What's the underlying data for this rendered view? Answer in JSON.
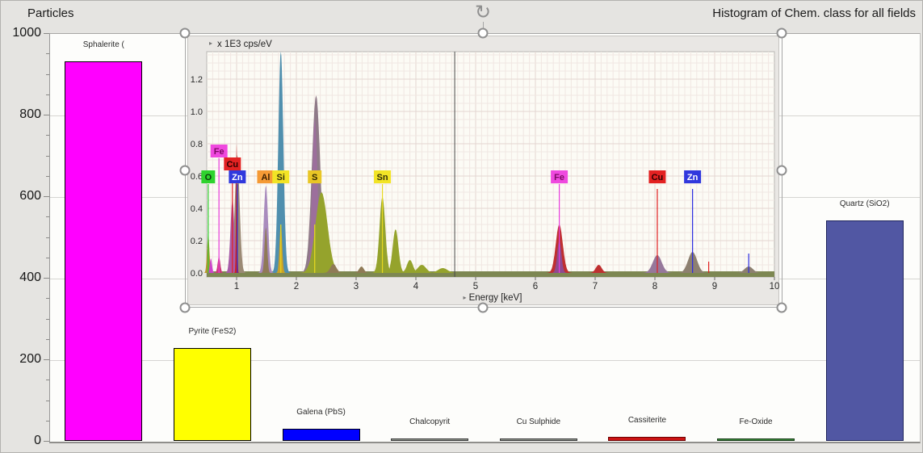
{
  "header": {
    "left_title": "Particles",
    "right_title": "Histogram of Chem. class for all fields"
  },
  "icons": {
    "rotate": "↻",
    "axis_arrow": "▸"
  },
  "chart_data": [
    {
      "type": "bar",
      "title": "Histogram of Chem. class for all fields",
      "ylabel": "Particles",
      "ylim": [
        0,
        1000
      ],
      "y_ticks": [
        0,
        200,
        400,
        600,
        800,
        1000
      ],
      "y_minor_step": 50,
      "grid": true,
      "categories": [
        "Sphalerite (",
        "Pyrite (FeS2)",
        "Galena (PbS)",
        "Chalcopyrit",
        "Cu Sulphide",
        "Cassiterite",
        "Fe-Oxide",
        "Quartz (SiO2)"
      ],
      "values": [
        930,
        228,
        30,
        5,
        4,
        9,
        5,
        540
      ],
      "bar_colors": [
        "#ff00ff",
        "#ffff00",
        "#0000ff",
        "#8d938b",
        "#8d938b",
        "#cc1414",
        "#3a8a3a",
        "#5157a3"
      ],
      "bar_borders": [
        "#000000",
        "#000000",
        "#000010",
        "#3a3a3a",
        "#3a3a3a",
        "#6b0000",
        "#143914",
        "#20265c"
      ]
    },
    {
      "type": "area",
      "title": "EDS sum spectrum overlay",
      "unit_label": "x 1E3 cps/eV",
      "xlabel": "Energy [keV]",
      "xlim": [
        0.5,
        10
      ],
      "ylim": [
        0,
        1.4
      ],
      "x_ticks": [
        1,
        2,
        3,
        4,
        5,
        6,
        7,
        8,
        9,
        10
      ],
      "y_tick_labels": [
        "0.0",
        "0.2",
        "0.4",
        "0.6",
        "0.8",
        "1.0",
        "1.2"
      ],
      "cursor_kev": 4.65,
      "baseline_band": {
        "h": 0.012,
        "color": "#7d8752"
      },
      "peaks": [
        {
          "e": 1.74,
          "h": 1.37,
          "w": 0.042,
          "color": "#4f8fae"
        },
        {
          "e": 1.74,
          "h": 0.3,
          "w": 0.022,
          "color": "#c9a227"
        },
        {
          "e": 2.33,
          "h": 1.1,
          "w": 0.07,
          "color": "#8f7a88"
        },
        {
          "e": 2.31,
          "h": 0.95,
          "w": 0.045,
          "color": "#9c6f9c"
        },
        {
          "e": 2.42,
          "h": 0.5,
          "w": 0.1,
          "color": "#95a32c"
        },
        {
          "e": 2.62,
          "h": 0.055,
          "w": 0.05,
          "color": "#8f7a56"
        },
        {
          "e": 1.49,
          "h": 0.54,
          "w": 0.036,
          "color": "#a98bbd"
        },
        {
          "e": 1.49,
          "h": 0.28,
          "w": 0.022,
          "color": "#8f7a56"
        },
        {
          "e": 1.01,
          "h": 0.73,
          "w": 0.04,
          "color": "#9b8a75"
        },
        {
          "e": 0.93,
          "h": 0.45,
          "w": 0.033,
          "color": "#a85ca8"
        },
        {
          "e": 1.0,
          "h": 0.8,
          "w": 0.01,
          "color": "#cc2525"
        },
        {
          "e": 0.525,
          "h": 0.24,
          "w": 0.02,
          "color": "#b5952f"
        },
        {
          "e": 0.57,
          "h": 0.09,
          "w": 0.018,
          "color": "#cc44cc"
        },
        {
          "e": 0.705,
          "h": 0.1,
          "w": 0.022,
          "color": "#cc3a7a"
        },
        {
          "e": 3.09,
          "h": 0.04,
          "w": 0.04,
          "color": "#8f7a56"
        },
        {
          "e": 3.44,
          "h": 0.47,
          "w": 0.048,
          "color": "#95a32c"
        },
        {
          "e": 3.66,
          "h": 0.27,
          "w": 0.048,
          "color": "#95a32c"
        },
        {
          "e": 3.9,
          "h": 0.08,
          "w": 0.05,
          "color": "#95a32c"
        },
        {
          "e": 4.1,
          "h": 0.05,
          "w": 0.07,
          "color": "#95a32c"
        },
        {
          "e": 4.45,
          "h": 0.03,
          "w": 0.08,
          "color": "#95a32c"
        },
        {
          "e": 6.4,
          "h": 0.3,
          "w": 0.058,
          "color": "#bf3030"
        },
        {
          "e": 6.4,
          "h": 0.2,
          "w": 0.035,
          "color": "#8f4a8f"
        },
        {
          "e": 7.06,
          "h": 0.05,
          "w": 0.05,
          "color": "#bf3030"
        },
        {
          "e": 8.04,
          "h": 0.11,
          "w": 0.075,
          "color": "#96789b"
        },
        {
          "e": 8.63,
          "h": 0.13,
          "w": 0.075,
          "color": "#8d8070"
        },
        {
          "e": 9.57,
          "h": 0.04,
          "w": 0.07,
          "color": "#8d8070"
        }
      ],
      "markers": [
        {
          "e": 0.525,
          "to": 0.55,
          "color": "#2ecc2e"
        },
        {
          "e": 0.705,
          "to": 0.71,
          "color": "#e83ddd"
        },
        {
          "e": 0.93,
          "to": 0.63,
          "color": "#e02020"
        },
        {
          "e": 1.012,
          "to": 0.55,
          "color": "#2a2ae0"
        },
        {
          "e": 1.74,
          "to": 0.3,
          "color": "#e8d820"
        },
        {
          "e": 2.307,
          "to": 0.3,
          "color": "#e8d820"
        },
        {
          "e": 3.44,
          "to": 0.55,
          "color": "#e8d820"
        },
        {
          "e": 6.4,
          "to": 0.55,
          "color": "#e83ddd"
        },
        {
          "e": 8.04,
          "to": 0.52,
          "color": "#e02020"
        },
        {
          "e": 8.63,
          "to": 0.52,
          "color": "#2a2ae0"
        },
        {
          "e": 8.9,
          "to": 0.07,
          "color": "#e02020"
        },
        {
          "e": 9.57,
          "to": 0.12,
          "color": "#2a2ae0"
        }
      ],
      "element_labels": [
        {
          "text": "O",
          "e": 0.525,
          "row": 0,
          "bg": "#2ed32e",
          "fg": "#0b3b0b"
        },
        {
          "text": "Fe",
          "e": 0.705,
          "row": 2,
          "bg": "#ef49df",
          "fg": "#7c0a63"
        },
        {
          "text": "Cu",
          "e": 0.93,
          "row": 1,
          "bg": "#e32222",
          "fg": "#2d0000"
        },
        {
          "text": "Zn",
          "e": 1.012,
          "row": 0,
          "bg": "#3038dd",
          "fg": "#ffffff"
        },
        {
          "text": "Al",
          "e": 1.486,
          "row": 0,
          "bg": "#f59a35",
          "fg": "#3d2000"
        },
        {
          "text": "Si",
          "e": 1.74,
          "row": 0,
          "bg": "#f2e426",
          "fg": "#33300a"
        },
        {
          "text": "S",
          "e": 2.307,
          "row": 0,
          "bg": "#e9c625",
          "fg": "#332800"
        },
        {
          "text": "Sn",
          "e": 3.44,
          "row": 0,
          "bg": "#f2e426",
          "fg": "#33300a"
        },
        {
          "text": "Fe",
          "e": 6.4,
          "row": 0,
          "bg": "#ef49df",
          "fg": "#7c0a63"
        },
        {
          "text": "Cu",
          "e": 8.04,
          "row": 0,
          "bg": "#e32222",
          "fg": "#2d0000"
        },
        {
          "text": "Zn",
          "e": 8.63,
          "row": 0,
          "bg": "#3038dd",
          "fg": "#ffffff"
        }
      ]
    }
  ]
}
